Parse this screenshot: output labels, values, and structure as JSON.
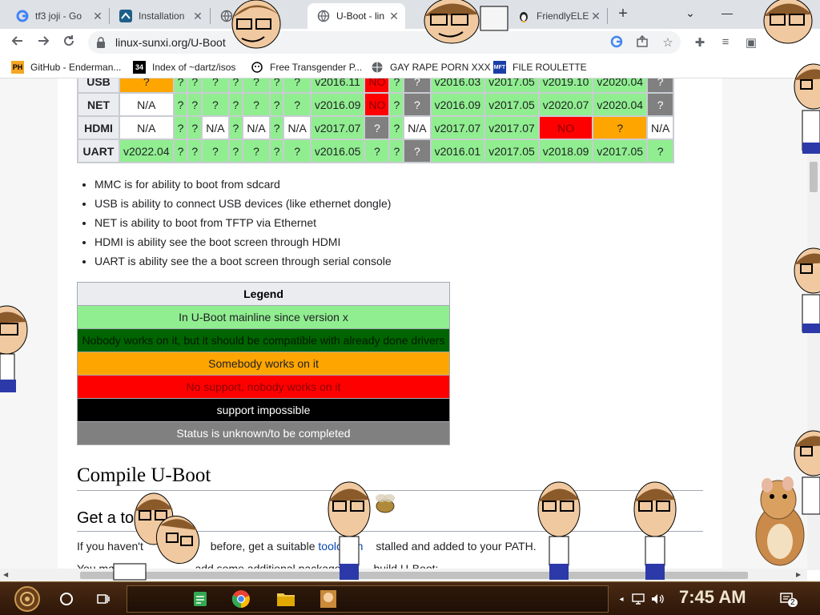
{
  "tabs": [
    {
      "title": "tf3 joji - Go",
      "favicon": "google-icon"
    },
    {
      "title": "Installation",
      "favicon": "arch-icon"
    },
    {
      "title": "",
      "favicon": "globe-icon"
    },
    {
      "title": "U-Boot - lin",
      "favicon": "globe-icon",
      "active": true
    },
    {
      "title": "",
      "favicon": "character-icon"
    },
    {
      "title": "FriendlyELE",
      "favicon": "penguin-icon"
    }
  ],
  "tab_close_glyph": "✕",
  "new_tab_glyph": "+",
  "window_controls": {
    "dropdown": "⌄",
    "minimize": "—",
    "close": "✕"
  },
  "address_bar": {
    "url": "linux-sunxi.org/U-Boot"
  },
  "bookmarks": [
    {
      "label": "GitHub - Enderman...",
      "icon": "PH"
    },
    {
      "label": "Index of ~dartz/isos",
      "icon": "34"
    },
    {
      "label": "Free Transgender P...",
      "icon": "face"
    },
    {
      "label": "GAY RAPE PORN XXX",
      "icon": "globe"
    },
    {
      "label": "FILE ROULETTE",
      "icon": "MFT"
    }
  ],
  "support_table": {
    "rows": [
      {
        "name": "USB",
        "cells": [
          {
            "t": "?",
            "c": "o"
          },
          {
            "t": "?",
            "c": "g"
          },
          {
            "t": "?",
            "c": "g"
          },
          {
            "t": "?",
            "c": "g"
          },
          {
            "t": "?",
            "c": "g"
          },
          {
            "t": "?",
            "c": "g"
          },
          {
            "t": "?",
            "c": "g"
          },
          {
            "t": "?",
            "c": "g"
          },
          {
            "t": "v2016.11",
            "c": "g"
          },
          {
            "t": "NO",
            "c": "r"
          },
          {
            "t": "?",
            "c": "g"
          },
          {
            "t": "?",
            "c": "x"
          },
          {
            "t": "v2016.03",
            "c": "g"
          },
          {
            "t": "v2017.05",
            "c": "g"
          },
          {
            "t": "v2019.10",
            "c": "g"
          },
          {
            "t": "v2020.04",
            "c": "g"
          },
          {
            "t": "?",
            "c": "x"
          }
        ]
      },
      {
        "name": "NET",
        "cells": [
          {
            "t": "N/A",
            "c": "w"
          },
          {
            "t": "?",
            "c": "g"
          },
          {
            "t": "?",
            "c": "g"
          },
          {
            "t": "?",
            "c": "g"
          },
          {
            "t": "?",
            "c": "g"
          },
          {
            "t": "?",
            "c": "g"
          },
          {
            "t": "?",
            "c": "g"
          },
          {
            "t": "?",
            "c": "g"
          },
          {
            "t": "v2016.09",
            "c": "g"
          },
          {
            "t": "NO",
            "c": "r"
          },
          {
            "t": "?",
            "c": "g"
          },
          {
            "t": "?",
            "c": "x"
          },
          {
            "t": "v2016.09",
            "c": "g"
          },
          {
            "t": "v2017.05",
            "c": "g"
          },
          {
            "t": "v2020.07",
            "c": "g"
          },
          {
            "t": "v2020.04",
            "c": "g"
          },
          {
            "t": "?",
            "c": "x"
          }
        ]
      },
      {
        "name": "HDMI",
        "cells": [
          {
            "t": "N/A",
            "c": "w"
          },
          {
            "t": "?",
            "c": "g"
          },
          {
            "t": "?",
            "c": "g"
          },
          {
            "t": "N/A",
            "c": "w"
          },
          {
            "t": "?",
            "c": "g"
          },
          {
            "t": "N/A",
            "c": "w"
          },
          {
            "t": "?",
            "c": "g"
          },
          {
            "t": "N/A",
            "c": "w"
          },
          {
            "t": "v2017.07",
            "c": "g"
          },
          {
            "t": "?",
            "c": "x"
          },
          {
            "t": "?",
            "c": "g"
          },
          {
            "t": "N/A",
            "c": "w"
          },
          {
            "t": "v2017.07",
            "c": "g"
          },
          {
            "t": "v2017.07",
            "c": "g"
          },
          {
            "t": "NO",
            "c": "r"
          },
          {
            "t": "?",
            "c": "o"
          },
          {
            "t": "N/A",
            "c": "w"
          }
        ]
      },
      {
        "name": "UART",
        "cells": [
          {
            "t": "v2022.04",
            "c": "g"
          },
          {
            "t": "?",
            "c": "g"
          },
          {
            "t": "?",
            "c": "g"
          },
          {
            "t": "?",
            "c": "g"
          },
          {
            "t": "?",
            "c": "g"
          },
          {
            "t": "?",
            "c": "g"
          },
          {
            "t": "?",
            "c": "g"
          },
          {
            "t": "?",
            "c": "g"
          },
          {
            "t": "v2016.05",
            "c": "g"
          },
          {
            "t": "?",
            "c": "g"
          },
          {
            "t": "?",
            "c": "g"
          },
          {
            "t": "?",
            "c": "x"
          },
          {
            "t": "v2016.01",
            "c": "g"
          },
          {
            "t": "v2017.05",
            "c": "g"
          },
          {
            "t": "v2018.09",
            "c": "g"
          },
          {
            "t": "v2017.05",
            "c": "g"
          },
          {
            "t": "?",
            "c": "g"
          }
        ]
      }
    ]
  },
  "notes": [
    "MMC is for ability to boot from sdcard",
    "USB is ability to connect USB devices (like ethernet dongle)",
    "NET is ability to boot from TFTP via Ethernet",
    "HDMI is ability see the boot screen through HDMI",
    "UART is ability see the a boot screen through serial console"
  ],
  "legend": {
    "title": "Legend",
    "rows": [
      {
        "text": "In U-Boot mainline since version x",
        "bg": "#90ee90",
        "fg": "#202124"
      },
      {
        "text": "Nobody works on it, but it should be compatible with already done drivers",
        "bg": "#006400",
        "fg": "#001a00"
      },
      {
        "text": "Somebody works on it",
        "bg": "#ffa500",
        "fg": "#202124"
      },
      {
        "text": "No support, nobody works on it",
        "bg": "#ff0000",
        "fg": "#8b0000"
      },
      {
        "text": "support impossible",
        "bg": "#000000",
        "fg": "#ffffff"
      },
      {
        "text": "Status is unknown/to be completed",
        "bg": "#808080",
        "fg": "#ffffff"
      }
    ]
  },
  "section_heading": "Compile U-Boot",
  "subsection_heading": "Get a to",
  "paragraph_1": {
    "before": "If you haven't",
    "middle": "before, get a suitable ",
    "link": "toolchain",
    "after": "stalled and added to your PATH."
  },
  "paragraph_2": {
    "before": "You may also",
    "after": "add some additional packages",
    "end": "build U-Boot:"
  },
  "taskbar": {
    "clock": "7:45 AM",
    "notification_count": "2"
  },
  "colors": {
    "accent_link": "#0645ad",
    "tabstrip_bg": "#dee1e6",
    "taskbar_bg": "#3a1f0d"
  }
}
